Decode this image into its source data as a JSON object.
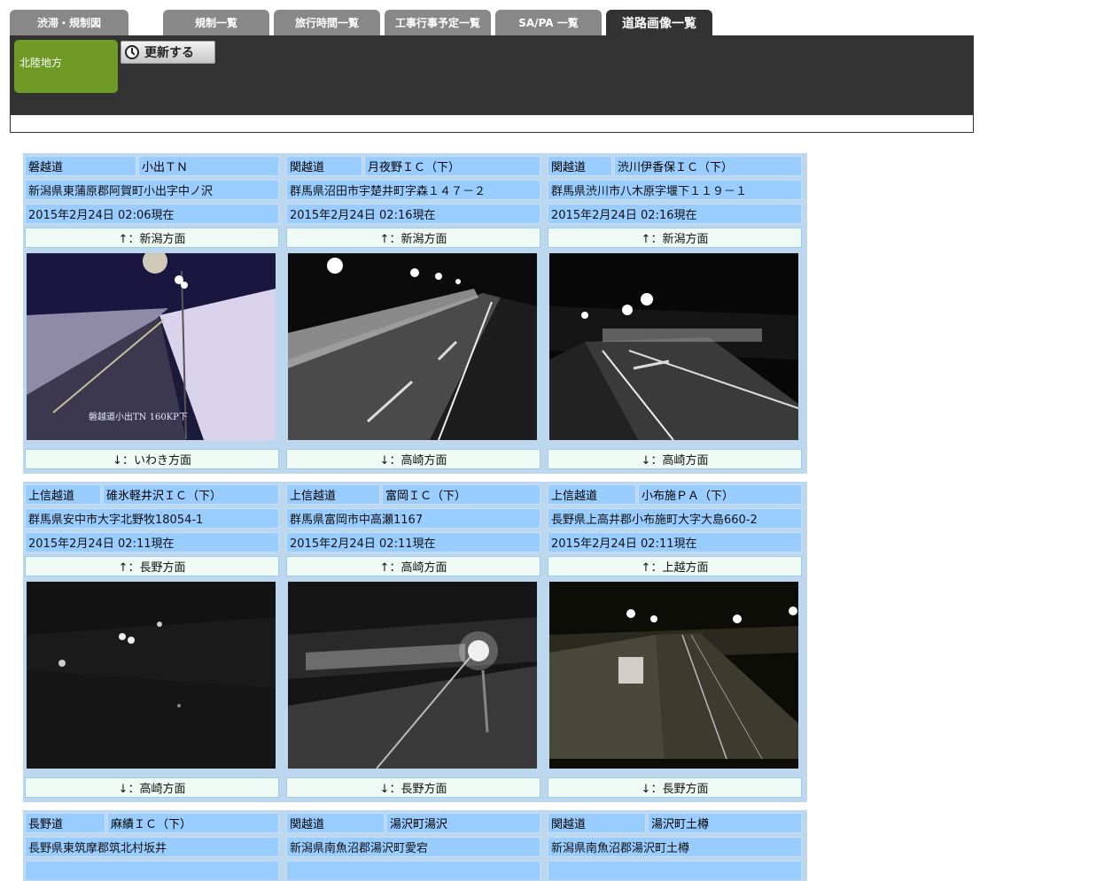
{
  "tabs": [
    {
      "label": "渋滞・規制図"
    },
    {
      "label": "規制一覧"
    },
    {
      "label": "旅行時間一覧"
    },
    {
      "label": "工事行事予定一覧"
    },
    {
      "label": "SA/PA 一覧"
    },
    {
      "label": "道路画像一覧"
    }
  ],
  "region": "北陸地方",
  "refresh_label": "更新する",
  "cameras": [
    {
      "road": "磐越道",
      "place": "小出ＴＮ",
      "address": "新潟県東蒲原郡阿賀町小出字中ノ沢",
      "time": "2015年2月24日 02:06現在",
      "up": "↑：新潟方面",
      "down": "↓：いわき方面",
      "overlay": "磐越道小出TN 160KP下"
    },
    {
      "road": "関越道",
      "place": "月夜野ＩＣ（下）",
      "address": "群馬県沼田市宇楚井町字森１４７－２",
      "time": "2015年2月24日 02:16現在",
      "up": "↑：新潟方面",
      "down": "↓：高崎方面"
    },
    {
      "road": "関越道",
      "place": "渋川伊香保ＩＣ（下）",
      "address": "群馬県渋川市八木原字堰下１１９－１",
      "time": "2015年2月24日 02:16現在",
      "up": "↑：新潟方面",
      "down": "↓：高崎方面"
    },
    {
      "road": "上信越道",
      "place": "碓氷軽井沢ＩＣ（下）",
      "address": "群馬県安中市大字北野牧18054-1",
      "time": "2015年2月24日 02:11現在",
      "up": "↑：長野方面",
      "down": "↓：高崎方面"
    },
    {
      "road": "上信越道",
      "place": "富岡ＩＣ（下）",
      "address": "群馬県富岡市中高瀬1167",
      "time": "2015年2月24日 02:11現在",
      "up": "↑：高崎方面",
      "down": "↓：長野方面"
    },
    {
      "road": "上信越道",
      "place": "小布施ＰＡ（下）",
      "address": "長野県上高井郡小布施町大字大島660-2",
      "time": "2015年2月24日 02:11現在",
      "up": "↑：上越方面",
      "down": "↓：長野方面"
    },
    {
      "road": "長野道",
      "place": "麻績ＩＣ（下）",
      "address": "長野県東筑摩郡筑北村坂井"
    },
    {
      "road": "関越道",
      "place": "湯沢町湯沢",
      "address": "新潟県南魚沼郡湯沢町愛宕"
    },
    {
      "road": "関越道",
      "place": "湯沢町土樽",
      "address": "新潟県南魚沼郡湯沢町土樽"
    }
  ],
  "colors": {
    "tab": "#888888",
    "tab_active": "#333333",
    "region": "#6f9a26",
    "cell_blue": "#99ccff",
    "cell_green": "#eefaf3",
    "frame": "#bcd7ee"
  }
}
